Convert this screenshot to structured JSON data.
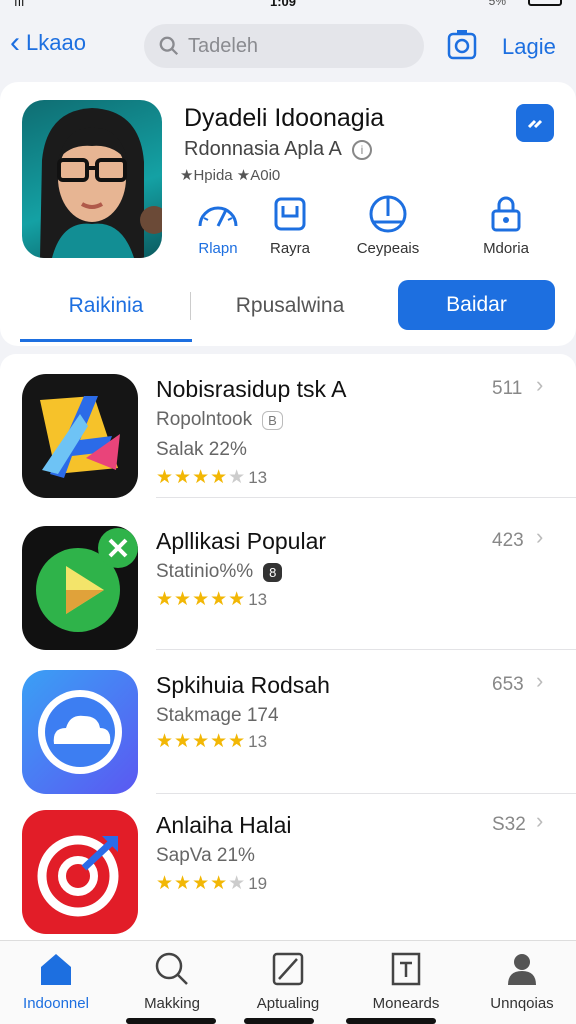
{
  "status": {
    "left": "ııl",
    "center": "1:09",
    "right": "5%"
  },
  "nav": {
    "back_label": "Lkaao",
    "search_placeholder": "Tadeleh",
    "login_label": "Lagie"
  },
  "hero": {
    "title": "Dyadeli Idoonagia",
    "subtitle": "Rdonnasia Apla A",
    "rating": "★Hpida ★A0i0",
    "actions": [
      {
        "label": "Rlapn",
        "icon": "speedometer-icon"
      },
      {
        "label": "Rayra",
        "icon": "bag-icon"
      },
      {
        "label": "Ceypeais",
        "icon": "globe-icon"
      },
      {
        "label": "Mdoria",
        "icon": "lock-icon"
      }
    ],
    "tabs": {
      "tab1": "Raikinia",
      "tab2": "Rpusalwina",
      "tab3": "Baidar"
    }
  },
  "apps": [
    {
      "name": "Nobisrasidup tsk A",
      "meta": "Ropolntook",
      "badge": "B",
      "meta2": "Salak 22%",
      "rating": 3.5,
      "rating_count": "13",
      "rank": "511",
      "icon": "arrow-a-icon"
    },
    {
      "name": "Apllikasi Popular",
      "meta": "Statinio%%",
      "badge": "8",
      "meta2": "",
      "rating": 4.5,
      "rating_count": "13",
      "rank": "423",
      "icon": "play-icon"
    },
    {
      "name": "Spkihuia Rodsah",
      "meta": "Stakmage 174",
      "badge": "",
      "meta2": "",
      "rating": 5,
      "rating_count": "13",
      "rank": "653",
      "icon": "cloud-icon"
    },
    {
      "name": "Anlaiha Halai",
      "meta": "SapVa 21%",
      "badge": "",
      "meta2": "",
      "rating": 3.5,
      "rating_count": "19",
      "rank": "S32",
      "icon": "target-icon"
    }
  ],
  "tabbar": [
    {
      "label": "Indoonnel",
      "icon": "home-icon",
      "active": true
    },
    {
      "label": "Makking",
      "icon": "search-icon",
      "active": false
    },
    {
      "label": "Aptualing",
      "icon": "edit-icon",
      "active": false
    },
    {
      "label": "Moneards",
      "icon": "document-icon",
      "active": false
    },
    {
      "label": "Unnqoias",
      "icon": "person-icon",
      "active": false
    }
  ],
  "colors": {
    "accent": "#1d6fe0",
    "star": "#f2b705"
  }
}
